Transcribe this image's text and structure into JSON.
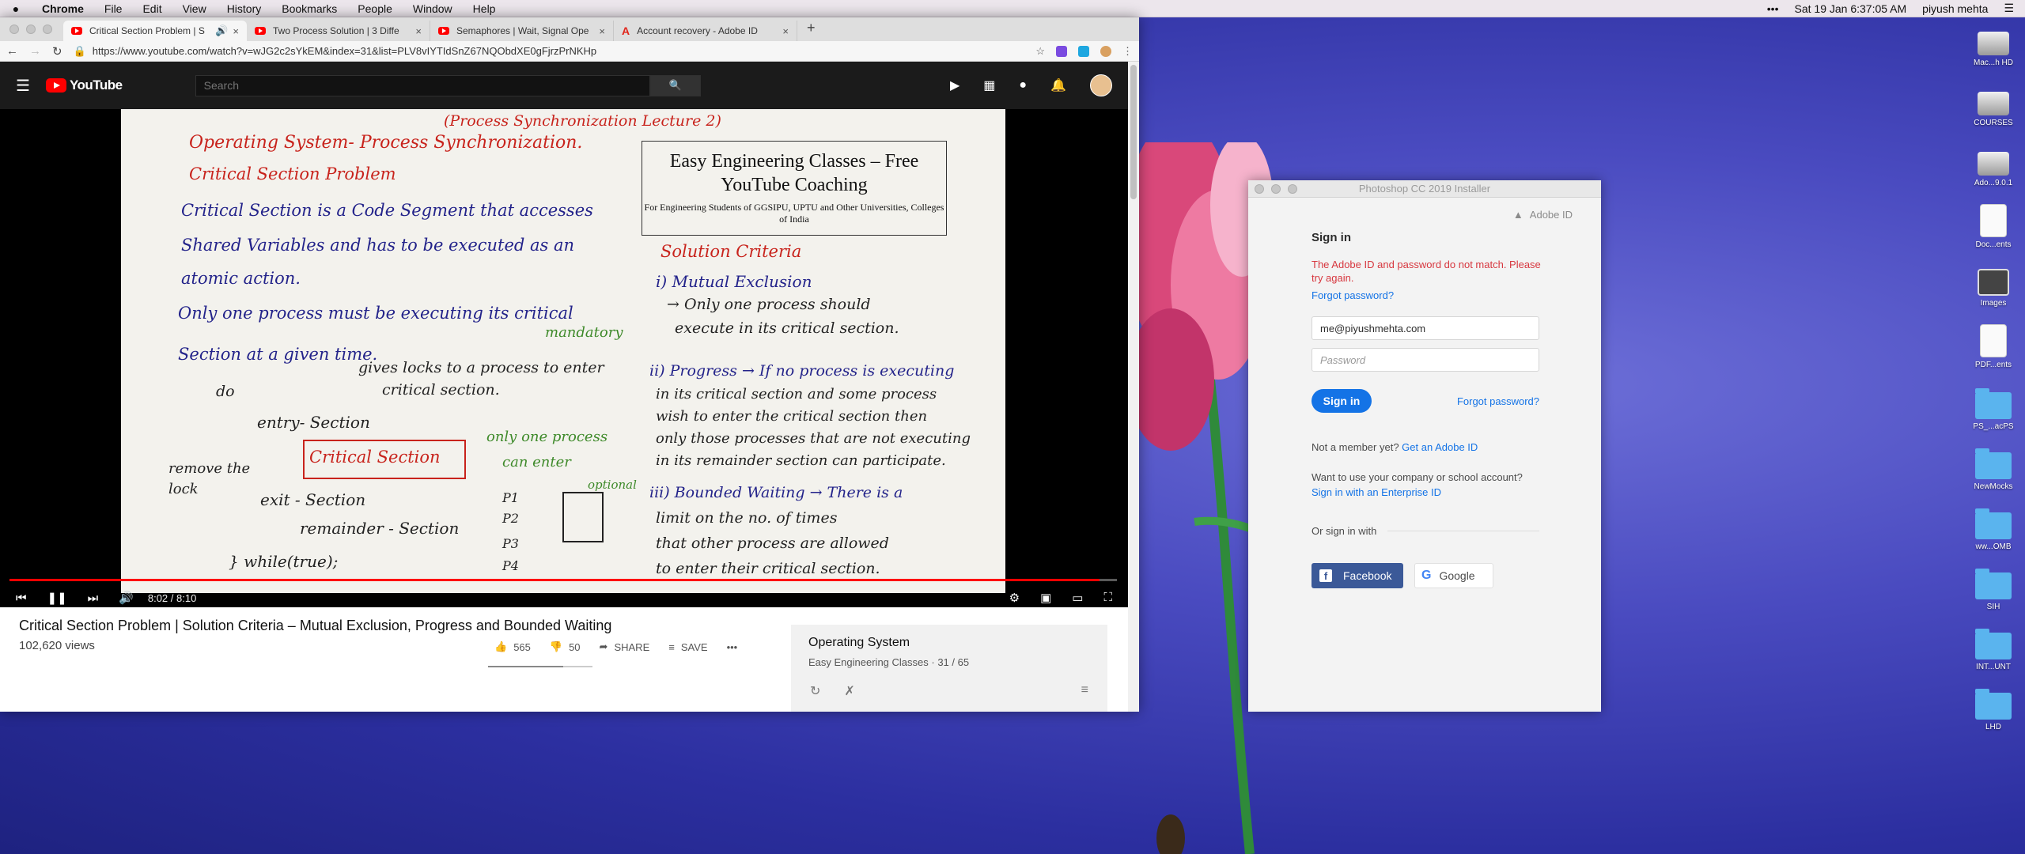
{
  "menubar": {
    "app": "Chrome",
    "items": [
      "File",
      "Edit",
      "View",
      "History",
      "Bookmarks",
      "People",
      "Window",
      "Help"
    ],
    "datetime": "Sat 19 Jan  6:37:05 AM",
    "user": "piyush mehta"
  },
  "browser": {
    "tabs": [
      {
        "label": "Critical Section Problem | S",
        "icon": "youtube-icon",
        "active": true
      },
      {
        "label": "Two Process Solution | 3 Diffe",
        "icon": "youtube-icon",
        "active": false
      },
      {
        "label": "Semaphores | Wait, Signal Ope",
        "icon": "youtube-icon",
        "active": false
      },
      {
        "label": "Account recovery - Adobe ID",
        "icon": "adobe-icon",
        "active": false
      }
    ],
    "url": "https://www.youtube.com/watch?v=wJG2c2sYkEM&index=31&list=PLV8vIYTIdSnZ67NQObdXE0gFjrzPrNKHp"
  },
  "youtube": {
    "logo": "YouTube",
    "search_placeholder": "Search",
    "video": {
      "title": "Critical Section Problem | Solution Criteria – Mutual Exclusion, Progress and Bounded Waiting",
      "views": "102,620 views",
      "likes": "565",
      "dislikes": "50",
      "share": "SHARE",
      "save": "SAVE",
      "time": "8:02 / 8:10",
      "progress": 0.984
    },
    "playlist": {
      "title": "Operating System",
      "channel": "Easy Engineering Classes",
      "position": "31 / 65"
    },
    "board": {
      "header": "(Process Synchronization Lecture 2)",
      "title": "Operating System- Process Synchronization.",
      "subtitle": "Critical Section Problem",
      "def1": "Critical Section is a Code Segment that accesses",
      "def2": "Shared Variables and has to be executed as an",
      "def3": "atomic action.",
      "rule1": "Only one process must be executing its critical",
      "rule2": "Section at a given time.",
      "mandatory": "mandatory",
      "gives1": "gives locks to a process to enter",
      "gives2": "critical section.",
      "do": "do",
      "entry": "entry- Section",
      "cs": "Critical Section",
      "only1": "only one process",
      "only2": "can enter",
      "remove1": "remove the",
      "remove2": "lock",
      "exit": "exit - Section",
      "remainder": "remainder - Section",
      "while": "} while(true);",
      "p1": "P1",
      "p2": "P2",
      "p3": "P3",
      "p4": "P4",
      "optional": "optional",
      "ec_title": "Easy Engineering Classes – Free YouTube Coaching",
      "ec_sub": "For Engineering Students of GGSIPU, UPTU and Other Universities, Colleges of India",
      "criteria": "Solution Criteria",
      "c1": "i) Mutual Exclusion",
      "c1a": "→ Only one process should",
      "c1b": "execute in its critical section.",
      "c2": "ii) Progress → If no process is executing",
      "c2a": "in its critical section and some process",
      "c2b": "wish to enter the critical section then",
      "c2c": "only those processes that are not executing",
      "c2d": "in its remainder section can participate.",
      "c3": "iii) Bounded Waiting → There is a",
      "c3a": "limit on the no. of times",
      "c3b": "that other process are allowed",
      "c3c": "to enter their critical section."
    }
  },
  "installer": {
    "window_title": "Photoshop CC 2019 Installer",
    "brand": "Adobe ID",
    "heading": "Sign in",
    "error": "The Adobe ID and password do not match. Please try again.",
    "forgot": "Forgot password?",
    "email_value": "me@piyushmehta.com",
    "password_placeholder": "Password",
    "sign_in": "Sign in",
    "not_member": "Not a member yet?",
    "get_id": "Get an Adobe ID",
    "company_q": "Want to use your company or school account?",
    "enterprise": "Sign in with an Enterprise ID",
    "or_sign": "Or sign in with",
    "facebook": "Facebook",
    "google": "Google"
  },
  "desktop": {
    "icons": [
      {
        "label": "Mac...h HD",
        "type": "drive"
      },
      {
        "label": "COURSES",
        "type": "drive"
      },
      {
        "label": "Ado...9.0.1",
        "type": "drive"
      },
      {
        "label": "Doc...ents",
        "type": "document"
      },
      {
        "label": "Images",
        "type": "image"
      },
      {
        "label": "PDF...ents",
        "type": "document"
      },
      {
        "label": "PS_...acPS",
        "type": "folder"
      },
      {
        "label": "NewMocks",
        "type": "folder"
      },
      {
        "label": "ww...OMB",
        "type": "folder"
      },
      {
        "label": "SIH",
        "type": "folder"
      },
      {
        "label": "INT...UNT",
        "type": "folder"
      },
      {
        "label": "LHD",
        "type": "folder"
      }
    ]
  },
  "colors": {
    "youtube_red": "#ff0000",
    "adobe_blue": "#1473e6",
    "error_red": "#d7373f",
    "facebook_blue": "#3b5998"
  }
}
